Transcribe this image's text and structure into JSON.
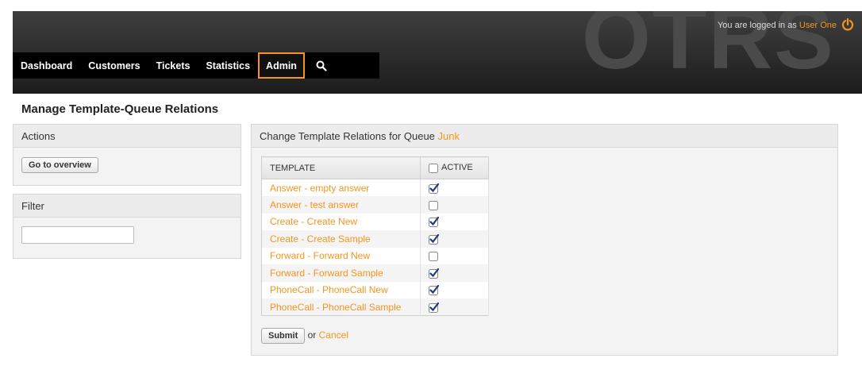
{
  "header": {
    "logo_text": "OTRS",
    "login_prefix": "You are logged in as",
    "user_name": "User One"
  },
  "nav": {
    "items": [
      {
        "label": "Dashboard"
      },
      {
        "label": "Customers"
      },
      {
        "label": "Tickets"
      },
      {
        "label": "Statistics"
      },
      {
        "label": "Admin",
        "active": true
      }
    ],
    "search_icon": "search-icon"
  },
  "page": {
    "title": "Manage Template-Queue Relations"
  },
  "sidebar": {
    "actions": {
      "title": "Actions",
      "overview_button": "Go to overview"
    },
    "filter": {
      "title": "Filter",
      "value": ""
    }
  },
  "main": {
    "heading_prefix": "Change Template Relations for Queue",
    "queue": "Junk",
    "columns": {
      "template": "TEMPLATE",
      "active": "ACTIVE"
    },
    "rows": [
      {
        "template": "Answer - empty answer",
        "active": true
      },
      {
        "template": "Answer - test answer",
        "active": false
      },
      {
        "template": "Create - Create New",
        "active": true
      },
      {
        "template": "Create - Create Sample",
        "active": true
      },
      {
        "template": "Forward - Forward New",
        "active": false
      },
      {
        "template": "Forward - Forward Sample",
        "active": true
      },
      {
        "template": "PhoneCall - PhoneCall New",
        "active": true
      },
      {
        "template": "PhoneCall - PhoneCall Sample",
        "active": true
      }
    ],
    "submit_label": "Submit",
    "or_text": "or",
    "cancel_label": "Cancel"
  },
  "colors": {
    "accent": "#f7941d",
    "header_dark": "#1c1c1c"
  }
}
